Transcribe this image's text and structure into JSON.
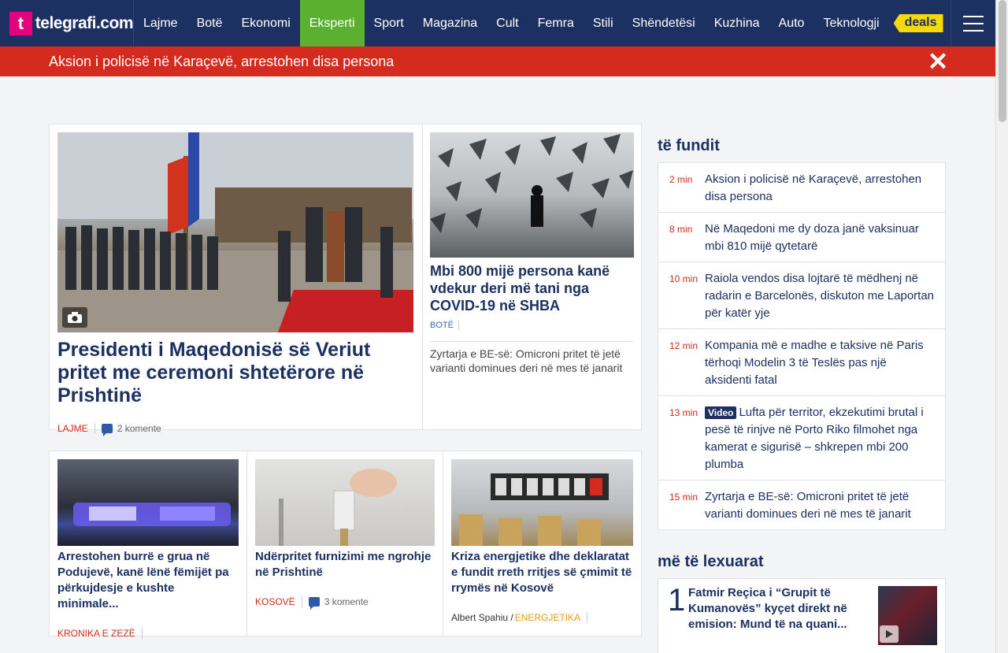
{
  "brand": {
    "logo_mark": "t",
    "name": "telegrafi.com"
  },
  "nav": {
    "items": [
      "Lajme",
      "Botë",
      "Ekonomi",
      "Eksperti",
      "Sport",
      "Magazina",
      "Cult",
      "Femra",
      "Stili",
      "Shëndetësi",
      "Kuzhina",
      "Auto",
      "Teknologji"
    ],
    "active": "Eksperti",
    "deals": "deals"
  },
  "breaking": {
    "text": "Aksion i policisë në Karaçevë, arrestohen disa persona",
    "close": "✕"
  },
  "featured": {
    "title": "Presidenti i Maqedonisë së Veriut pritet me ceremoni shtetërore në Prishtinë",
    "category": "LAJME",
    "comments": "2 komente"
  },
  "side_story": {
    "title": "Mbi 800 mijë persona kanë vdekur deri më tani nga COVID-19 në SHBA",
    "category": "BOTË",
    "related": "Zyrtarja e BE-së: Omicroni pritet të jetë varianti dominues deri në mes të janarit"
  },
  "row2": [
    {
      "title": "Arrestohen burrë e grua në Podujevë, kanë lënë fëmijët pa përkujdesje e kushte minimale...",
      "category": "KRONIKA E ZEZË"
    },
    {
      "title": "Ndërpritet furnizimi me ngrohje në Prishtinë",
      "category": "KOSOVË",
      "comments": "3 komente"
    },
    {
      "title": "Kriza energjetike dhe deklaratat e fundit rreth rritjes së çmimit të rrymës në Kosovë",
      "author": "Albert Spahiu /",
      "category": "ENERGJETIKA"
    }
  ],
  "sidebar": {
    "latest_heading": "të fundit",
    "latest": [
      {
        "time": "2 min",
        "title": "Aksion i policisë në Karaçevë, arrestohen disa persona"
      },
      {
        "time": "8 min",
        "title": "Në Maqedoni me dy doza janë vaksinuar mbi 810 mijë qytetarë"
      },
      {
        "time": "10 min",
        "title": "Raiola vendos disa lojtarë të mëdhenj në radarin e Barcelonës, diskuton me Laportan për katër yje"
      },
      {
        "time": "12 min",
        "title": "Kompania më e madhe e taksive në Paris tërhoqi Modelin 3 të Teslës pas një aksidenti fatal"
      },
      {
        "time": "13 min",
        "badge": "Video",
        "title": "Lufta për territor, ekzekutimi brutal i pesë të rinjve në Porto Riko filmohet nga kamerat e sigurisë – shkrepen mbi 200 plumba"
      },
      {
        "time": "15 min",
        "title": "Zyrtarja e BE-së: Omicroni pritet të jetë varianti dominues deri në mes të janarit"
      }
    ],
    "mostread_heading": "më të lexuarat",
    "mostread": {
      "rank": "1",
      "title": "Fatmir Reçica i “Grupit të Kumanovës” kyçet direkt në emision: Mund të na quani..."
    }
  },
  "colors": {
    "navy": "#1c3161",
    "active_nav": "#5bb02f",
    "breaking": "#d42b1e",
    "deals": "#f5d90a",
    "logo": "#e6007e"
  }
}
